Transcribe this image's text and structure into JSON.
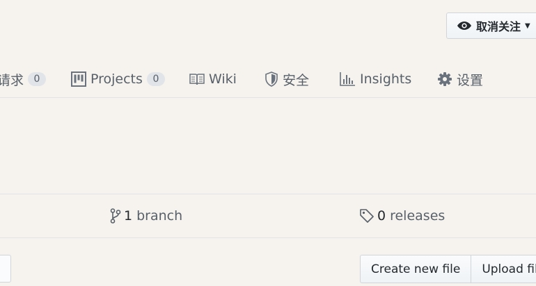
{
  "header": {
    "unwatch_label": "取消关注"
  },
  "tabs": [
    {
      "label": "请求",
      "count": "0",
      "icon": "pull-request-icon"
    },
    {
      "label": "Projects",
      "count": "0",
      "icon": "project-icon"
    },
    {
      "label": "Wiki",
      "icon": "book-icon"
    },
    {
      "label": "安全",
      "icon": "shield-icon"
    },
    {
      "label": "Insights",
      "icon": "graph-icon"
    },
    {
      "label": "设置",
      "icon": "gear-icon"
    }
  ],
  "summary": {
    "branches_count": "1",
    "branches_label": "branch",
    "releases_count": "0",
    "releases_label": "releases"
  },
  "file_actions": {
    "create_label": "Create new file",
    "upload_label": "Upload files"
  },
  "colors": {
    "background": "#f6f3ee",
    "border": "#e1e4e8",
    "muted_text": "#586069"
  }
}
